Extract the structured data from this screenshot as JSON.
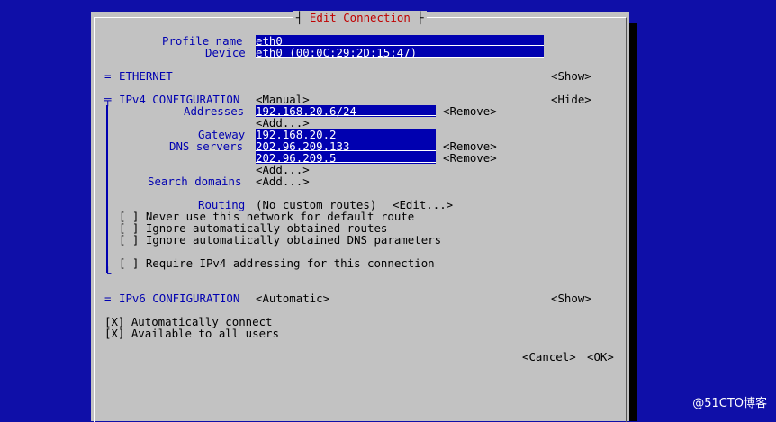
{
  "dialog": {
    "title": "Edit Connection",
    "profile_name_label": "Profile name",
    "profile_name_value": "eth0",
    "device_label": "Device",
    "device_value": "eth0 (00:0C:29:2D:15:47)"
  },
  "ethernet": {
    "marker": "=",
    "header": "ETHERNET",
    "toggle": "<Show>"
  },
  "ipv4": {
    "marker": "╤",
    "header": "IPv4 CONFIGURATION",
    "method": "<Manual>",
    "toggle": "<Hide>",
    "addresses_label": "Addresses",
    "address_value": "192.168.20.6/24",
    "remove_label": "<Remove>",
    "add_label": "<Add...>",
    "gateway_label": "Gateway",
    "gateway_value": "192.168.20.2",
    "dns_label": "DNS servers",
    "dns_1": "202.96.209.133",
    "dns_2": "202.96.209.5",
    "search_label": "Search domains",
    "routing_label": "Routing",
    "routing_value": "(No custom routes)",
    "edit_label": "<Edit...>",
    "opt_never_default": "[ ] Never use this network for default route",
    "opt_ignore_routes": "[ ] Ignore automatically obtained routes",
    "opt_ignore_dns": "[ ] Ignore automatically obtained DNS parameters",
    "opt_require_ipv4": "[ ] Require IPv4 addressing for this connection",
    "end_marker": "└"
  },
  "ipv6": {
    "marker": "=",
    "header": "IPv6 CONFIGURATION",
    "method": "<Automatic>",
    "toggle": "<Show>"
  },
  "general": {
    "auto_connect": "[X] Automatically connect",
    "all_users": "[X] Available to all users"
  },
  "buttons": {
    "cancel": "<Cancel>",
    "ok": "<OK>"
  },
  "watermark": "@51CTO博客",
  "colors": {
    "background": "#0f0fa8",
    "window": "#c2c2c2",
    "label": "#0000b0",
    "title": "#c00000",
    "field_bg": "#0000b0",
    "field_text": "#ffffff"
  }
}
